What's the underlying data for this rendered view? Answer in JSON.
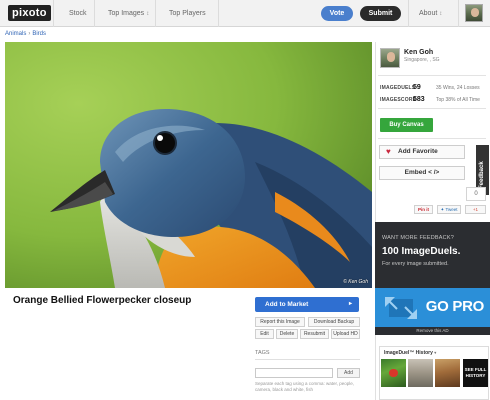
{
  "app": {
    "logo": "pixoto"
  },
  "nav": {
    "stock": "Stock",
    "top_images": "Top Images",
    "top_players": "Top Players",
    "vote": "Vote",
    "submit": "Submit",
    "about": "About",
    "caret": "↕"
  },
  "breadcrumb": {
    "parent": "Animals",
    "separator": "›",
    "current": "Birds"
  },
  "photo": {
    "copyright": "© Ken Goh",
    "title": "Orange Bellied Flowerpecker closeup"
  },
  "actions": {
    "add_to_market": "Add to Market",
    "arrow": "▸",
    "report": "Report this Image",
    "download_backup": "Download Backup",
    "edit": "Edit",
    "delete": "Delete",
    "resubmit": "Resubmit",
    "upload_hd": "Upload HD"
  },
  "tags": {
    "label": "TAGS",
    "add": "Add",
    "help": "Separate each tag using a comma: water, people, camera, black and white, fish"
  },
  "profile": {
    "name": "Ken Goh",
    "location": "Singapore, , SG"
  },
  "stats": {
    "imageduels_label": "IMAGEDUELS",
    "imageduels_value": "59",
    "imageduels_detail": "35 Wins, 24 Losses",
    "imagescore_label": "IMAGESCORE",
    "imagescore_value": "583",
    "imagescore_detail": "Top 38% of All Time"
  },
  "sidebar": {
    "buy_canvas": "Buy Canvas",
    "add_favorite": "Add Favorite",
    "embed": "Embed < />",
    "feedback": "Feedback",
    "count": "0",
    "pinit": "Pin it",
    "tweet": "Tweet",
    "gplus": "+1"
  },
  "ad": {
    "small": "WANT MORE FEEDBACK?",
    "big": "100 ImageDuels.",
    "sub": "For every image submitted.",
    "go": "GO PRO",
    "remove": "Remove this AD"
  },
  "history": {
    "title": "ImageDuel™ History",
    "caret": "▾",
    "see_full": "SEE FULL HISTORY"
  },
  "colors": {
    "accent_blue": "#2f6fd1",
    "vote_blue": "#4a7fcd",
    "buy_green": "#35a63c",
    "ad_dark": "#2b2d31",
    "ad_blue": "#2b8fd8"
  }
}
